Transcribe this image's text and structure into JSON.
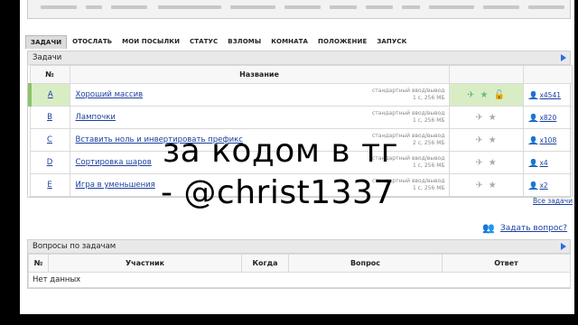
{
  "tabs": [
    {
      "label": "ЗАДАЧИ",
      "active": true
    },
    {
      "label": "ОТОСЛАТЬ",
      "active": false
    },
    {
      "label": "МОИ ПОСЫЛКИ",
      "active": false
    },
    {
      "label": "СТАТУС",
      "active": false
    },
    {
      "label": "ВЗЛОМЫ",
      "active": false
    },
    {
      "label": "КОМНАТА",
      "active": false
    },
    {
      "label": "ПОЛОЖЕНИЕ",
      "active": false
    },
    {
      "label": "ЗАПУСК",
      "active": false
    }
  ],
  "problems": {
    "title": "Задачи",
    "col_num": "№",
    "col_name": "Название",
    "rows": [
      {
        "letter": "A",
        "name": "Хороший массив",
        "io": "стандартный ввод/вывод",
        "limits": "1 с, 256 МБ",
        "solvers": "x4541",
        "solved": true
      },
      {
        "letter": "B",
        "name": "Лампочки",
        "io": "стандартный ввод/вывод",
        "limits": "1 с, 256 МБ",
        "solvers": "x820",
        "solved": false
      },
      {
        "letter": "C",
        "name": "Вставить ноль и инвертировать префикс",
        "io": "стандартный ввод/вывод",
        "limits": "2 с, 256 МБ",
        "solvers": "x108",
        "solved": false
      },
      {
        "letter": "D",
        "name": "Сортировка шаров",
        "io": "стандартный ввод/вывод",
        "limits": "1 с, 256 МБ",
        "solvers": "x4",
        "solved": false
      },
      {
        "letter": "E",
        "name": "Игра в уменьшения",
        "io": "стандартный ввод/вывод",
        "limits": "1 с, 256 МБ",
        "solvers": "x2",
        "solved": false
      }
    ],
    "all_tasks": "Все задачи"
  },
  "ask_question": "Задать вопрос?",
  "questions": {
    "title": "Вопросы по задачам",
    "cols": [
      "№",
      "Участник",
      "Когда",
      "Вопрос",
      "Ответ"
    ],
    "empty": "Нет данных"
  },
  "overlay": {
    "line1": "за кодом в тг",
    "line2": "- @christ1337"
  }
}
